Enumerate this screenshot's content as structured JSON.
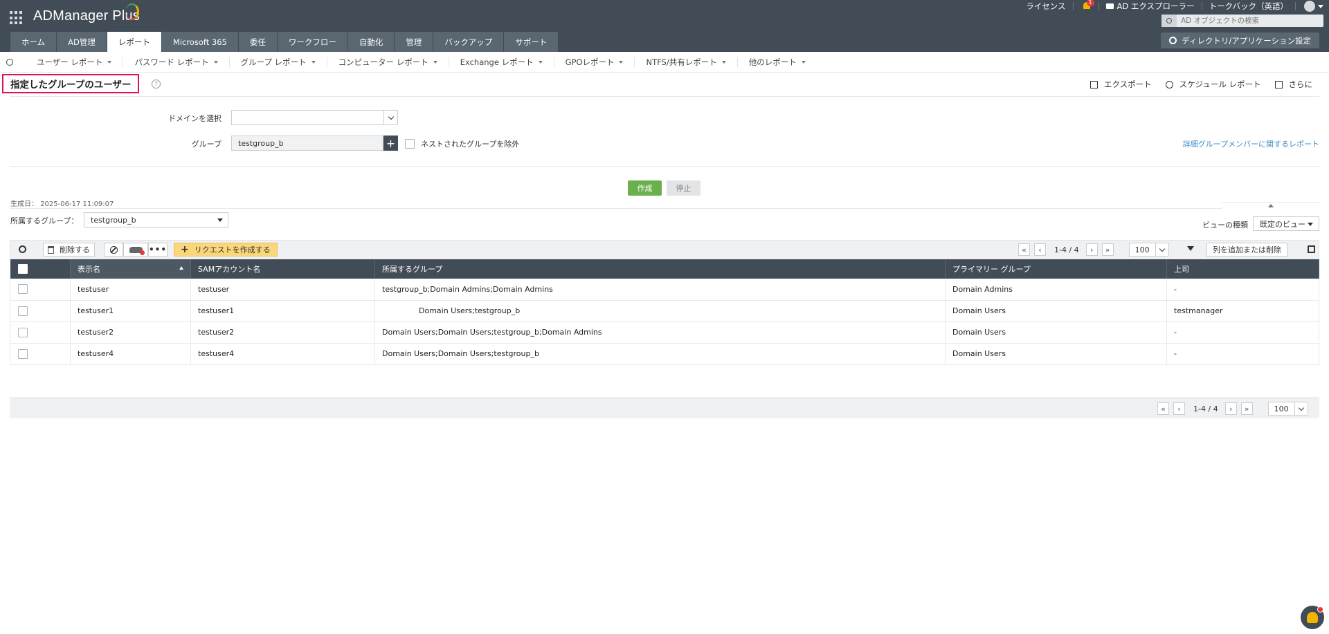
{
  "app": {
    "name": "ADManager Plus"
  },
  "top_links": {
    "license": "ライセンス",
    "notif_count": "1",
    "ad_explorer": "AD エクスプローラー",
    "talkback": "トークバック（英語）"
  },
  "search": {
    "placeholder": "AD オブジェクトの検索"
  },
  "tabs": [
    {
      "label": "ホーム"
    },
    {
      "label": "AD管理"
    },
    {
      "label": "レポート",
      "active": true
    },
    {
      "label": "Microsoft 365"
    },
    {
      "label": "委任"
    },
    {
      "label": "ワークフロー"
    },
    {
      "label": "自動化"
    },
    {
      "label": "管理"
    },
    {
      "label": "バックアップ"
    },
    {
      "label": "サポート"
    }
  ],
  "dir_settings": "ディレクトリ/アプリケーション設定",
  "subnav": [
    "ユーザー レポート",
    "パスワード レポート",
    "グループ レポート",
    "コンピューター レポート",
    "Exchange レポート",
    "GPOレポート",
    "NTFS/共有レポート",
    "他のレポート"
  ],
  "page": {
    "title": "指定したグループのユーザー",
    "help": "?"
  },
  "actions": {
    "export": "エクスポート",
    "schedule": "スケジュール レポート",
    "more": "さらに"
  },
  "form": {
    "domain_label": "ドメインを選択",
    "domain_value": "",
    "group_label": "グループ",
    "group_value": "testgroup_b",
    "exclude_nested": "ネストされたグループを除外",
    "detail_link": "詳細グループメンバーに関するレポート",
    "generate": "作成",
    "stop": "停止"
  },
  "generated": "生成日： 2025-06-17 11:09:07",
  "member_of": {
    "label": "所属するグループ：",
    "value": "testgroup_b"
  },
  "view": {
    "label": "ビューの種類",
    "value": "既定のビュー"
  },
  "toolbar": {
    "delete": "削除する",
    "dots": "•••",
    "request": "リクエストを作成する",
    "add_cols": "列を追加または削除"
  },
  "pagination": {
    "first": "«",
    "prev": "‹",
    "text": "1-4 / 4",
    "next": "›",
    "last": "»",
    "per_page": "100"
  },
  "table": {
    "columns": [
      "表示名",
      "SAMアカウント名",
      "所属するグループ",
      "プライマリー グループ",
      "上司"
    ],
    "rows": [
      [
        "testuser",
        "testuser",
        "testgroup_b;Domain Admins;Domain Admins",
        "Domain Admins",
        "-"
      ],
      [
        "testuser1",
        "testuser1",
        "Domain Users;testgroup_b",
        "Domain Users",
        "testmanager"
      ],
      [
        "testuser2",
        "testuser2",
        "Domain Users;Domain Users;testgroup_b;Domain Admins",
        "Domain Users",
        "-"
      ],
      [
        "testuser4",
        "testuser4",
        "Domain Users;Domain Users;testgroup_b",
        "Domain Users",
        "-"
      ]
    ]
  }
}
